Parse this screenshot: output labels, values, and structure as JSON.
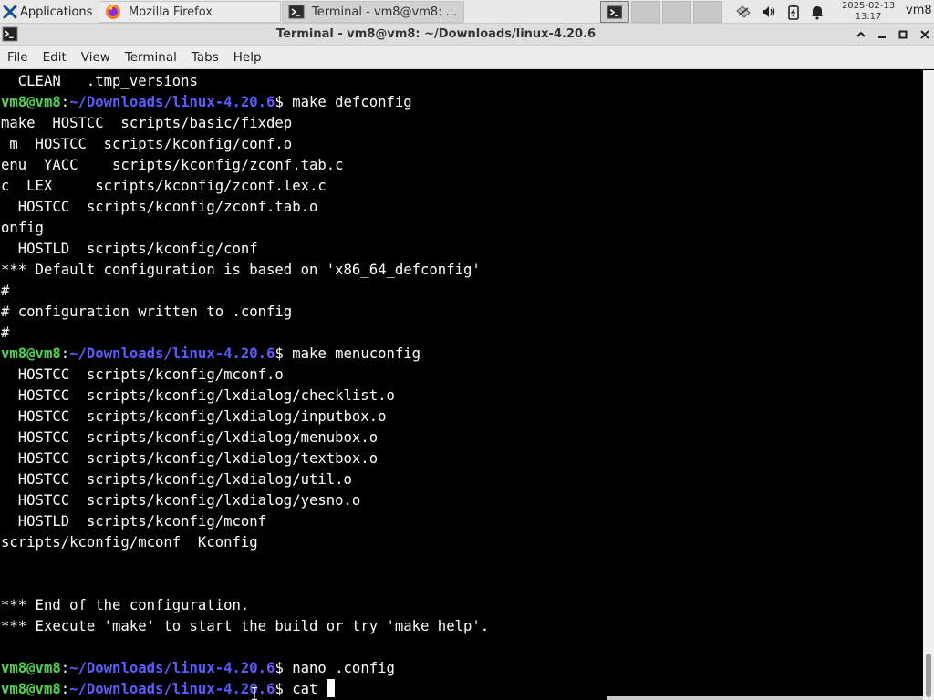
{
  "panel": {
    "applications_label": "Applications",
    "tasks": [
      {
        "label": "Mozilla Firefox",
        "icon": "firefox-icon"
      },
      {
        "label": "Terminal - vm8@vm8: ...",
        "icon": "terminal-icon"
      }
    ],
    "clock": {
      "date": "2025-02-13",
      "time": "13:17"
    },
    "user": "vm8"
  },
  "window": {
    "title": "Terminal - vm8@vm8: ~/Downloads/linux-4.20.6",
    "controls": {
      "maximize_up": "⌃",
      "minimize": "–",
      "restore": "□",
      "close": "✕"
    }
  },
  "menu": [
    "File",
    "Edit",
    "View",
    "Terminal",
    "Tabs",
    "Help"
  ],
  "prompt": {
    "user": "vm8@vm8",
    "sep": ":",
    "path": "~/Downloads/linux-4.20.6",
    "dollar": "$ "
  },
  "colors": {
    "prompt_user": "#4ed34e",
    "prompt_path": "#5c5cff",
    "text": "#ffffff",
    "background": "#000000"
  },
  "lines": [
    {
      "text": "  CLEAN   .tmp_versions"
    },
    {
      "prompt": true,
      "cmd": "make defconfig"
    },
    {
      "text": "make  HOSTCC  scripts/basic/fixdep"
    },
    {
      "text": " m  HOSTCC  scripts/kconfig/conf.o"
    },
    {
      "text": "enu  YACC    scripts/kconfig/zconf.tab.c"
    },
    {
      "text": "c  LEX     scripts/kconfig/zconf.lex.c"
    },
    {
      "text": "  HOSTCC  scripts/kconfig/zconf.tab.o"
    },
    {
      "text": "onfig"
    },
    {
      "text": "  HOSTLD  scripts/kconfig/conf"
    },
    {
      "text": "*** Default configuration is based on 'x86_64_defconfig'"
    },
    {
      "text": "#"
    },
    {
      "text": "# configuration written to .config"
    },
    {
      "text": "#"
    },
    {
      "prompt": true,
      "cmd": "make menuconfig"
    },
    {
      "text": "  HOSTCC  scripts/kconfig/mconf.o"
    },
    {
      "text": "  HOSTCC  scripts/kconfig/lxdialog/checklist.o"
    },
    {
      "text": "  HOSTCC  scripts/kconfig/lxdialog/inputbox.o"
    },
    {
      "text": "  HOSTCC  scripts/kconfig/lxdialog/menubox.o"
    },
    {
      "text": "  HOSTCC  scripts/kconfig/lxdialog/textbox.o"
    },
    {
      "text": "  HOSTCC  scripts/kconfig/lxdialog/util.o"
    },
    {
      "text": "  HOSTCC  scripts/kconfig/lxdialog/yesno.o"
    },
    {
      "text": "  HOSTLD  scripts/kconfig/mconf"
    },
    {
      "text": "scripts/kconfig/mconf  Kconfig"
    },
    {
      "text": ""
    },
    {
      "text": ""
    },
    {
      "text": "*** End of the configuration."
    },
    {
      "text": "*** Execute 'make' to start the build or try 'make help'."
    },
    {
      "text": ""
    },
    {
      "prompt": true,
      "cmd": "nano .config"
    },
    {
      "prompt": true,
      "cmd": "cat ",
      "cursor": true
    }
  ]
}
